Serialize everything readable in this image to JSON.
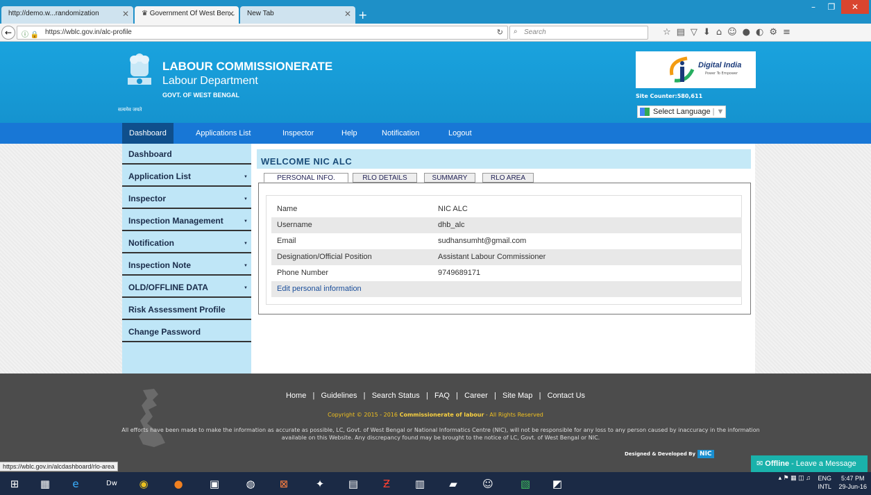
{
  "browser": {
    "tabs": [
      {
        "title": "http://demo.w...randomization"
      },
      {
        "title": "Government Of West Ben..."
      },
      {
        "title": "New Tab"
      }
    ],
    "url": "https://wblc.gov.in/alc-profile",
    "search_placeholder": "Search",
    "status_url": "https://wblc.gov.in/alcdashboard/rlo-area"
  },
  "header": {
    "org_title": "LABOUR COMMISSIONERATE",
    "org_sub": "Labour Department",
    "org_govt": "GOVT. OF WEST BENGAL",
    "motto": "सत्यमेव जयते",
    "digital_india": "Digital India",
    "digital_india_tag": "Power To Empower",
    "site_counter": "Site Counter:580,611",
    "language": "Select Language"
  },
  "menu": [
    "Dashboard",
    "Applications List",
    "Inspector",
    "Help",
    "Notification",
    "Logout"
  ],
  "sidebar": [
    {
      "label": "Dashboard",
      "caret": false
    },
    {
      "label": "Application List",
      "caret": true
    },
    {
      "label": "Inspector",
      "caret": true
    },
    {
      "label": "Inspection Management",
      "caret": true
    },
    {
      "label": "Notification",
      "caret": true
    },
    {
      "label": "Inspection Note",
      "caret": true
    },
    {
      "label": "OLD/OFFLINE DATA",
      "caret": true
    },
    {
      "label": "Risk Assessment Profile",
      "caret": false
    },
    {
      "label": "Change Password",
      "caret": false
    }
  ],
  "welcome": "WELCOME NIC ALC",
  "profile_tabs": [
    "PERSONAL INFO.",
    "RLO DETAILS",
    "SUMMARY",
    "RLO AREA"
  ],
  "profile": [
    {
      "key": "Name",
      "value": "NIC ALC"
    },
    {
      "key": "Username",
      "value": "dhb_alc"
    },
    {
      "key": "Email",
      "value": "sudhansumht@gmail.com"
    },
    {
      "key": "Designation/Official Position",
      "value": "Assistant Labour Commissioner"
    },
    {
      "key": "Phone Number",
      "value": "9749689171"
    }
  ],
  "edit_link": "Edit personal information",
  "footer": {
    "links": "Home   |   Guidelines   |   Search Status   |   FAQ   |   Career   |   Site Map   |   Contact Us",
    "copyright_prefix": "Copyright © 2015 - 2016 ",
    "copyright_org": "Commissionerate of labour",
    "copyright_suffix": " - All Rights Reserved",
    "disclaimer": "All efforts have been made to make the information as accurate as possible, LC, Govt. of West Bengal or National Informatics Centre (NIC), will not be responsible for any loss to any person caused by inaccuracy in the information available on this Website. Any discrepancy found may be brought to the notice of LC, Govt. of West Bengal or NIC.",
    "designed": "Designed & Developed By",
    "nic": "NIC"
  },
  "chat": {
    "status": "Offline",
    "message": " - Leave a Message"
  },
  "tray": {
    "lang1": "ENG",
    "lang2": "INTL",
    "time": "5:47 PM",
    "date": "29-Jun-16"
  }
}
